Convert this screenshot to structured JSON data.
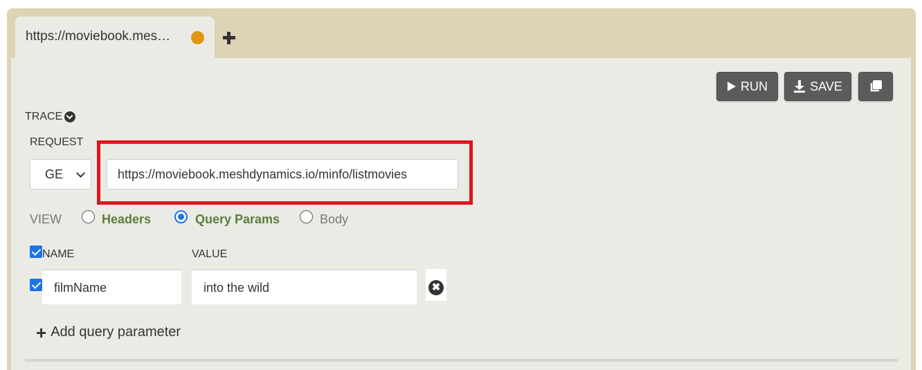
{
  "tab": {
    "title": "https://moviebook.mes…",
    "dot_color": "#e0960c"
  },
  "toolbar": {
    "run_label": "RUN",
    "save_label": "SAVE"
  },
  "trace": {
    "label": "TRACE"
  },
  "request": {
    "label": "REQUEST",
    "method": "GE",
    "url": "https://moviebook.meshdynamics.io/minfo/listmovies"
  },
  "view": {
    "label": "VIEW",
    "options": [
      {
        "label": "Headers",
        "checked": false
      },
      {
        "label": "Query Params",
        "checked": true
      },
      {
        "label": "Body",
        "checked": false
      }
    ]
  },
  "params": {
    "name_header": "NAME",
    "value_header": "VALUE",
    "rows": [
      {
        "name": "filmName",
        "value": "into the wild",
        "enabled": true
      }
    ],
    "add_label": "Add query parameter"
  }
}
